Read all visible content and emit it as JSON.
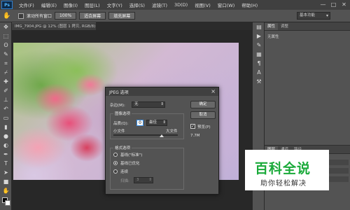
{
  "app": {
    "logo": "Ps"
  },
  "menu": {
    "items": [
      "文件(F)",
      "编辑(E)",
      "图像(I)",
      "图层(L)",
      "文字(Y)",
      "选择(S)",
      "滤镜(T)",
      "3D(D)",
      "视图(V)",
      "窗口(W)",
      "帮助(H)"
    ]
  },
  "window_controls": {
    "minimize": "—",
    "maximize": "□",
    "close": "✕"
  },
  "options_bar": {
    "scroll_all_label": "滚动所有窗口",
    "buttons": [
      "100%",
      "适合屏幕",
      "填充屏幕"
    ],
    "workspace": "基本功能"
  },
  "document_tab": {
    "title": "IMG_7904.JPG @ 12% (图层 1 拷贝, RGB/8)",
    "close": "×"
  },
  "right_panel": {
    "top_tabs": [
      "属性",
      "调整"
    ],
    "properties_text": "无属性",
    "bottom_tabs": [
      "图层",
      "通道",
      "路径"
    ]
  },
  "dialog": {
    "title": "JPEG 选项",
    "close": "×",
    "matte_label": "杂边(M):",
    "matte_value": "无",
    "image_options_title": "图像选项",
    "quality_label": "品质(Q):",
    "quality_value": "0",
    "quality_preset": "最佳",
    "small_file": "小文件",
    "large_file": "大文件",
    "quality_slider_fraction": 0.75,
    "format_options_title": "格式选项",
    "formats": [
      "基线(\"标准\")",
      "基线已优化",
      "连续"
    ],
    "selected_format_index": 1,
    "scans_label": "扫描:",
    "scans_value": "3",
    "ok": "确定",
    "cancel": "取消",
    "preview_label": "预览(P)",
    "preview_checked": true,
    "file_size": "7.7M"
  },
  "watermark": {
    "title": "百科全说",
    "subtitle": "助你轻松解决"
  }
}
